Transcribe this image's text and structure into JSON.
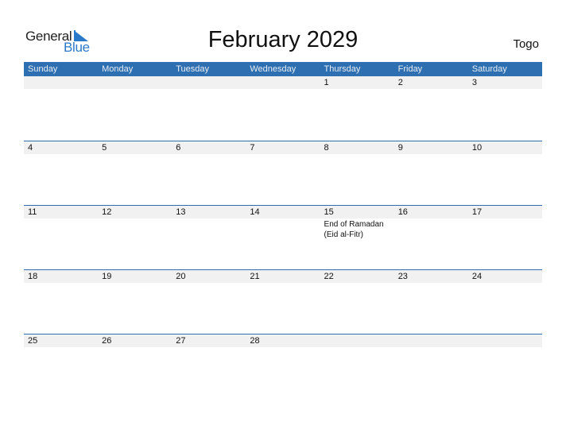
{
  "logo": {
    "general": "General",
    "blue": "Blue"
  },
  "title": "February 2029",
  "country": "Togo",
  "weekdays": [
    "Sunday",
    "Monday",
    "Tuesday",
    "Wednesday",
    "Thursday",
    "Friday",
    "Saturday"
  ],
  "weeks": [
    [
      {
        "d": ""
      },
      {
        "d": ""
      },
      {
        "d": ""
      },
      {
        "d": ""
      },
      {
        "d": "1"
      },
      {
        "d": "2"
      },
      {
        "d": "3"
      }
    ],
    [
      {
        "d": "4"
      },
      {
        "d": "5"
      },
      {
        "d": "6"
      },
      {
        "d": "7"
      },
      {
        "d": "8"
      },
      {
        "d": "9"
      },
      {
        "d": "10"
      }
    ],
    [
      {
        "d": "11"
      },
      {
        "d": "12"
      },
      {
        "d": "13"
      },
      {
        "d": "14"
      },
      {
        "d": "15",
        "event": "End of Ramadan (Eid al-Fitr)"
      },
      {
        "d": "16"
      },
      {
        "d": "17"
      }
    ],
    [
      {
        "d": "18"
      },
      {
        "d": "19"
      },
      {
        "d": "20"
      },
      {
        "d": "21"
      },
      {
        "d": "22"
      },
      {
        "d": "23"
      },
      {
        "d": "24"
      }
    ],
    [
      {
        "d": "25"
      },
      {
        "d": "26"
      },
      {
        "d": "27"
      },
      {
        "d": "28"
      },
      {
        "d": ""
      },
      {
        "d": ""
      },
      {
        "d": ""
      }
    ]
  ],
  "colors": {
    "header": "#2d6fb0",
    "brand_blue": "#2b7ac9",
    "date_strip": "#f1f1f1"
  }
}
